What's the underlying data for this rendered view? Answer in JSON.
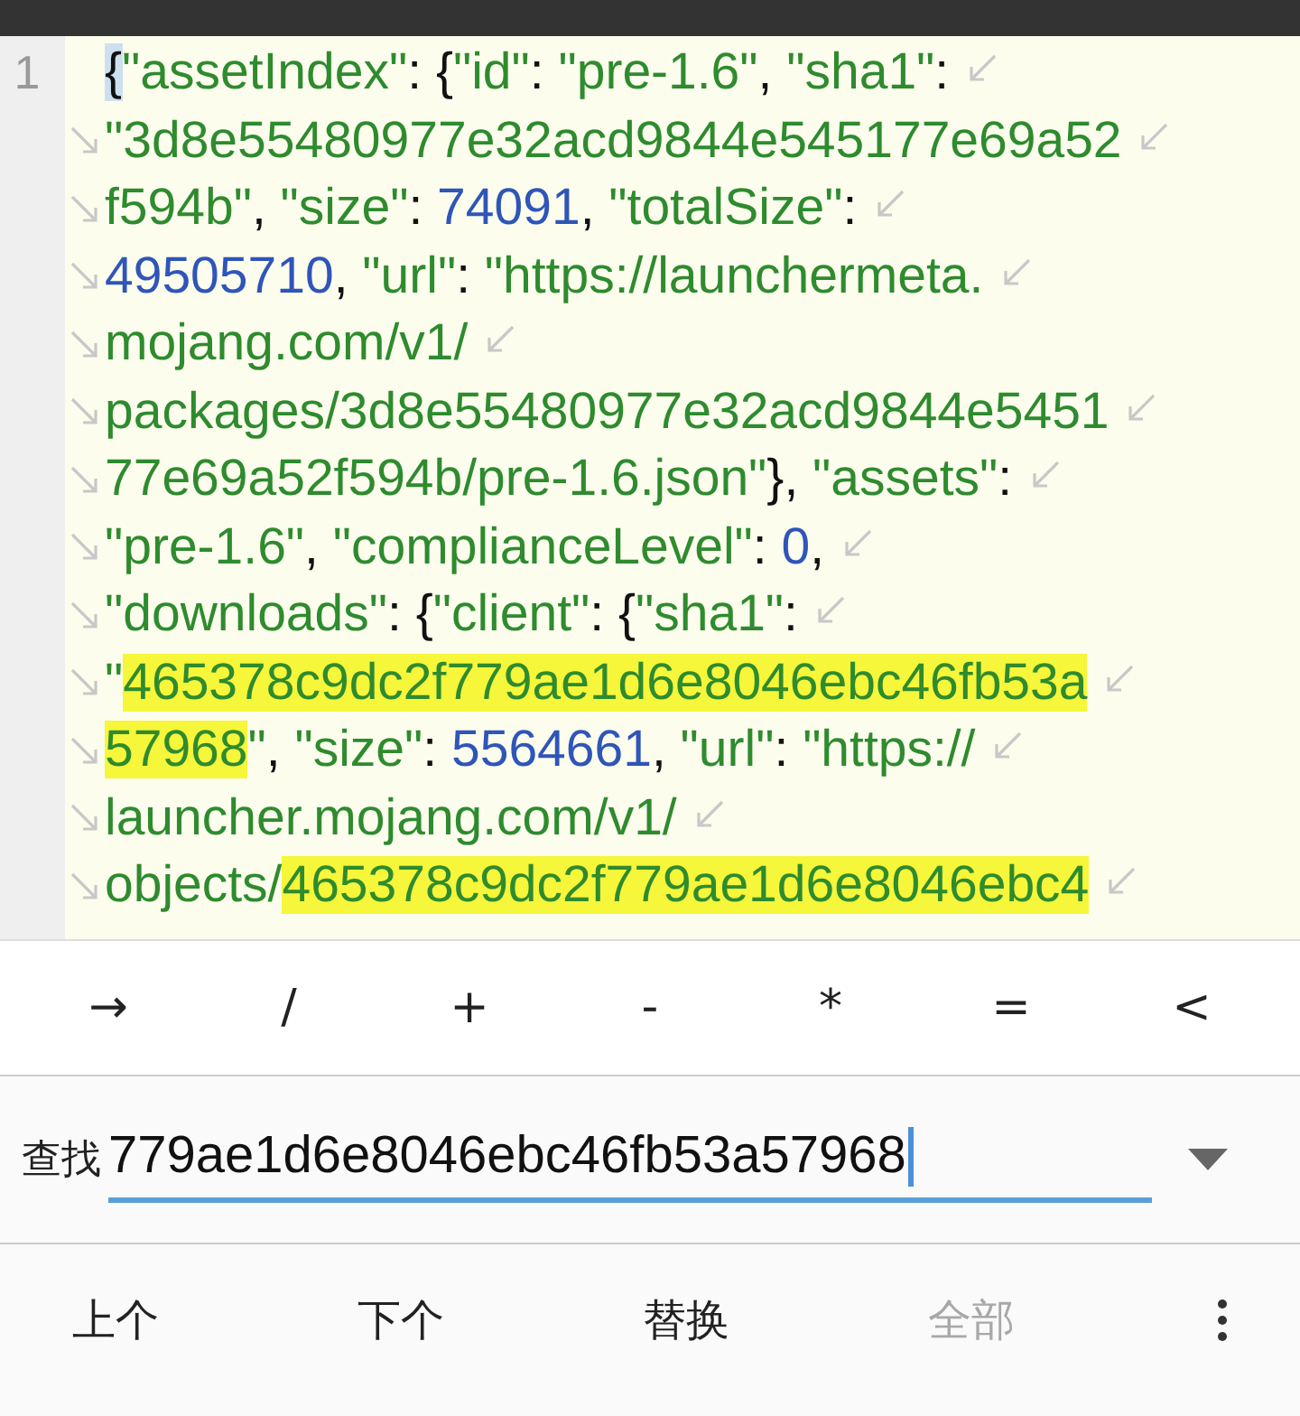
{
  "editor": {
    "rows": [
      {
        "line_number": "1",
        "segments": [
          {
            "text": "{",
            "kind": "punct",
            "highlighted": false,
            "cursor": true
          },
          {
            "text": "\"assetIndex\"",
            "kind": "string",
            "highlighted": false
          },
          {
            "text": ": {",
            "kind": "punct",
            "highlighted": false
          },
          {
            "text": "\"id\"",
            "kind": "string",
            "highlighted": false
          },
          {
            "text": ": ",
            "kind": "punct",
            "highlighted": false
          },
          {
            "text": "\"pre-1.6\"",
            "kind": "string",
            "highlighted": false
          },
          {
            "text": ", ",
            "kind": "punct",
            "highlighted": false
          },
          {
            "text": "\"sha1\"",
            "kind": "string",
            "highlighted": false
          },
          {
            "text": ":",
            "kind": "punct",
            "highlighted": false
          }
        ]
      },
      {
        "segments": [
          {
            "text": "\"3d8e55480977e32acd9844e545177e69a52",
            "kind": "string",
            "highlighted": false
          }
        ]
      },
      {
        "segments": [
          {
            "text": "f594b\"",
            "kind": "string",
            "highlighted": false
          },
          {
            "text": ", ",
            "kind": "punct",
            "highlighted": false
          },
          {
            "text": "\"size\"",
            "kind": "string",
            "highlighted": false
          },
          {
            "text": ": ",
            "kind": "punct",
            "highlighted": false
          },
          {
            "text": "74091",
            "kind": "number",
            "highlighted": false
          },
          {
            "text": ", ",
            "kind": "punct",
            "highlighted": false
          },
          {
            "text": "\"totalSize\"",
            "kind": "string",
            "highlighted": false
          },
          {
            "text": ":",
            "kind": "punct",
            "highlighted": false
          }
        ]
      },
      {
        "segments": [
          {
            "text": "49505710",
            "kind": "number",
            "highlighted": false
          },
          {
            "text": ", ",
            "kind": "punct",
            "highlighted": false
          },
          {
            "text": "\"url\"",
            "kind": "string",
            "highlighted": false
          },
          {
            "text": ": ",
            "kind": "punct",
            "highlighted": false
          },
          {
            "text": "\"https://launchermeta.",
            "kind": "string",
            "highlighted": false
          }
        ]
      },
      {
        "segments": [
          {
            "text": "mojang.com/v1/",
            "kind": "string",
            "highlighted": false
          }
        ]
      },
      {
        "segments": [
          {
            "text": "packages/3d8e55480977e32acd9844e5451",
            "kind": "string",
            "highlighted": false
          }
        ]
      },
      {
        "segments": [
          {
            "text": "77e69a52f594b/pre-1.6.json\"",
            "kind": "string",
            "highlighted": false
          },
          {
            "text": "}, ",
            "kind": "punct",
            "highlighted": false
          },
          {
            "text": "\"assets\"",
            "kind": "string",
            "highlighted": false
          },
          {
            "text": ":",
            "kind": "punct",
            "highlighted": false
          }
        ]
      },
      {
        "segments": [
          {
            "text": "\"pre-1.6\"",
            "kind": "string",
            "highlighted": false
          },
          {
            "text": ", ",
            "kind": "punct",
            "highlighted": false
          },
          {
            "text": "\"complianceLevel\"",
            "kind": "string",
            "highlighted": false
          },
          {
            "text": ": ",
            "kind": "punct",
            "highlighted": false
          },
          {
            "text": "0",
            "kind": "number",
            "highlighted": false
          },
          {
            "text": ",",
            "kind": "punct",
            "highlighted": false
          }
        ]
      },
      {
        "segments": [
          {
            "text": "\"downloads\"",
            "kind": "string",
            "highlighted": false
          },
          {
            "text": ": {",
            "kind": "punct",
            "highlighted": false
          },
          {
            "text": "\"client\"",
            "kind": "string",
            "highlighted": false
          },
          {
            "text": ": {",
            "kind": "punct",
            "highlighted": false
          },
          {
            "text": "\"sha1\"",
            "kind": "string",
            "highlighted": false
          },
          {
            "text": ":",
            "kind": "punct",
            "highlighted": false
          }
        ]
      },
      {
        "segments": [
          {
            "text": "\"",
            "kind": "string",
            "highlighted": false
          },
          {
            "text": "465378c9dc2f779ae1d6e8046ebc46fb53a",
            "kind": "string",
            "highlighted": true
          }
        ]
      },
      {
        "segments": [
          {
            "text": "57968",
            "kind": "string",
            "highlighted": true
          },
          {
            "text": "\"",
            "kind": "string",
            "highlighted": false
          },
          {
            "text": ", ",
            "kind": "punct",
            "highlighted": false
          },
          {
            "text": "\"size\"",
            "kind": "string",
            "highlighted": false
          },
          {
            "text": ": ",
            "kind": "punct",
            "highlighted": false
          },
          {
            "text": "5564661",
            "kind": "number",
            "highlighted": false
          },
          {
            "text": ", ",
            "kind": "punct",
            "highlighted": false
          },
          {
            "text": "\"url\"",
            "kind": "string",
            "highlighted": false
          },
          {
            "text": ": ",
            "kind": "punct",
            "highlighted": false
          },
          {
            "text": "\"https://",
            "kind": "string",
            "highlighted": false
          }
        ]
      },
      {
        "segments": [
          {
            "text": "launcher.mojang.com/v1/",
            "kind": "string",
            "highlighted": false
          }
        ]
      },
      {
        "segments": [
          {
            "text": "objects/",
            "kind": "string",
            "highlighted": false
          },
          {
            "text": "465378c9dc2f779ae1d6e8046ebc4",
            "kind": "string",
            "highlighted": true
          }
        ]
      }
    ]
  },
  "symbol_keys": [
    "→",
    "/",
    "+",
    "-",
    "*",
    "=",
    "<"
  ],
  "find_bar": {
    "label": "查找",
    "value": "779ae1d6e8046ebc46fb53a57968"
  },
  "actions": [
    {
      "label": "上个",
      "disabled": false
    },
    {
      "label": "下个",
      "disabled": false
    },
    {
      "label": "替换",
      "disabled": false
    },
    {
      "label": "全部",
      "disabled": true
    }
  ]
}
